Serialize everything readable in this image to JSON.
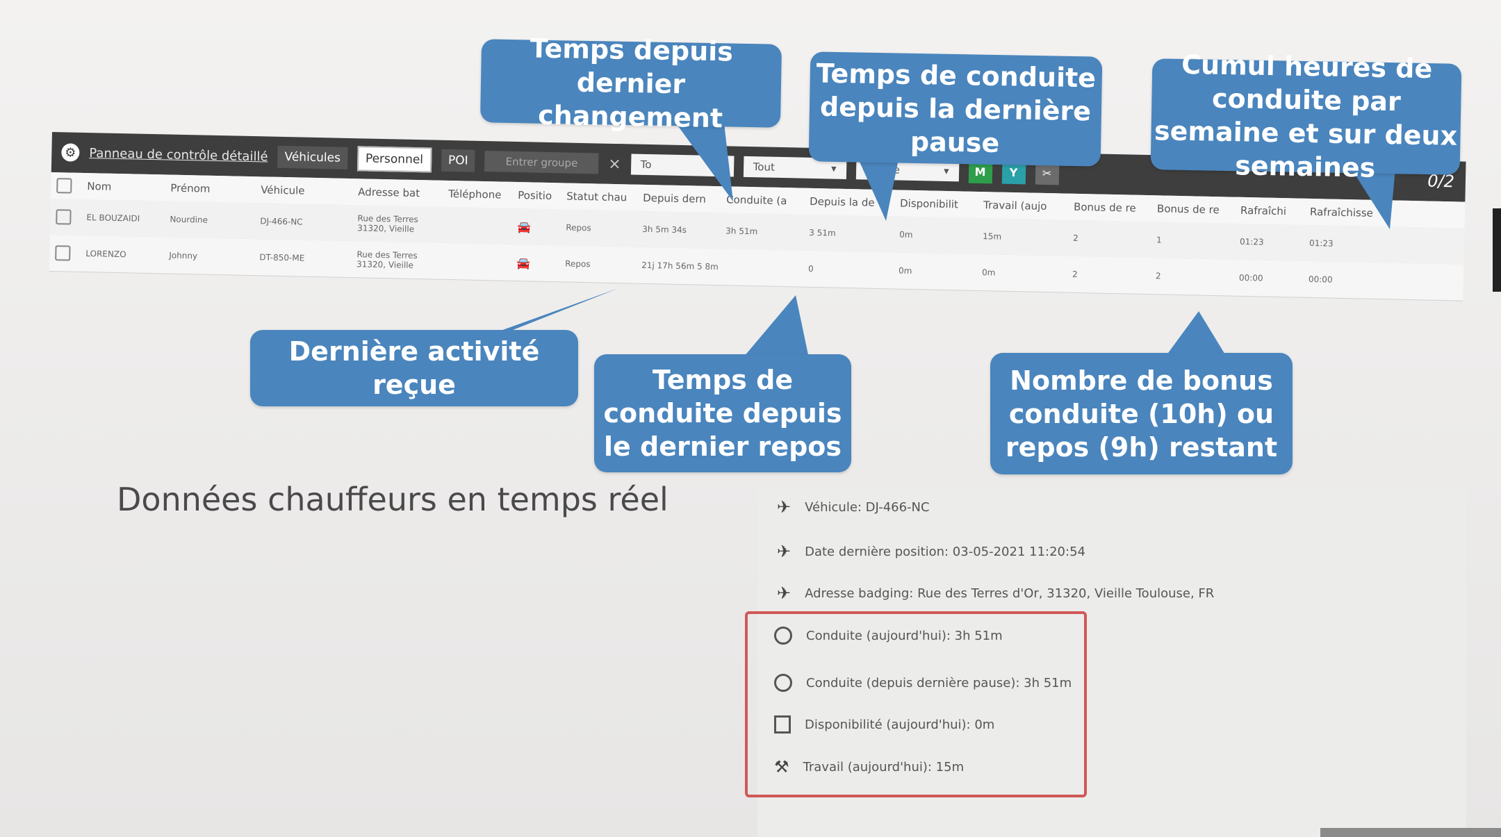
{
  "topbar": {
    "title": "Panneau de contrôle détaillé",
    "tabs": [
      "Véhicules",
      "Personnel",
      "POI"
    ],
    "group_placeholder": "Entrer groupe",
    "clear": "×",
    "selects": [
      "To",
      "Tout",
      "Tout le"
    ],
    "icon_buttons": [
      {
        "icon": "map-icon",
        "color": "#2e9e4b",
        "glyph": "M"
      },
      {
        "icon": "filter-icon",
        "color": "#2aa0a8",
        "glyph": "Y"
      },
      {
        "icon": "tools-icon",
        "color": "#6c6c6c",
        "glyph": "✂"
      }
    ],
    "count": "0/2"
  },
  "table": {
    "columns": [
      "Nom",
      "Prénom",
      "Véhicule",
      "Adresse bat",
      "Téléphone",
      "Positio",
      "Statut chau",
      "Depuis dern",
      "Conduite (a",
      "Depuis la de",
      "Disponibilit",
      "Travail (aujo",
      "Bonus de re",
      "Bonus de re",
      "Rafraîchi",
      "Rafraîchisse"
    ],
    "rows": [
      {
        "nom": "EL BOUZAIDI",
        "prenom": "Nourdine",
        "vehicule": "DJ-466-NC",
        "adresse": [
          "Rue des Terres",
          "31320, Vieille"
        ],
        "statut": "Repos",
        "depuis": "3h 5m 34s",
        "conduite": "3h 51m",
        "depuis_pause": "3 51m",
        "dispo": "0m",
        "travail": "15m",
        "bonus1": "2",
        "bonus2": "1",
        "rafr1": "01:23",
        "rafr2": "01:23"
      },
      {
        "nom": "LORENZO",
        "prenom": "Johnny",
        "vehicule": "DT-850-ME",
        "adresse": [
          "Rue des Terres",
          "31320, Vieille"
        ],
        "statut": "Repos",
        "depuis": "21j 17h 56m 5 8m",
        "conduite": "",
        "depuis_pause": "0",
        "dispo": "0m",
        "travail": "0m",
        "bonus1": "2",
        "bonus2": "2",
        "rafr1": "00:00",
        "rafr2": "00:00"
      }
    ]
  },
  "callouts": {
    "changement": "Temps depuis dernier changement",
    "pause": "Temps de conduite depuis la dernière pause",
    "cumul": "Cumul heures de conduite par semaine et sur deux semaines",
    "activite": "Dernière activité reçue",
    "repos": "Temps de conduite depuis le dernier repos",
    "bonus": "Nombre de bonus conduite (10h) ou repos (9h) restant"
  },
  "main_title": "Données chauffeurs en temps réel",
  "details": [
    {
      "icon": "pin-icon",
      "text": "Véhicule: DJ-466-NC"
    },
    {
      "icon": "pin-icon",
      "text": "Date dernière position: 03-05-2021 11:20:54"
    },
    {
      "icon": "pin-icon",
      "text": "Adresse badging: Rue des Terres d'Or, 31320, Vieille Toulouse, FR"
    },
    {
      "icon": "clock-icon",
      "text": "Conduite (aujourd'hui): 3h 51m"
    },
    {
      "icon": "clock-icon",
      "text": "Conduite (depuis dernière pause): 3h 51m"
    },
    {
      "icon": "square-icon",
      "text": "Disponibilité (aujourd'hui): 0m"
    },
    {
      "icon": "hammer-icon",
      "text": "Travail (aujourd'hui): 15m"
    }
  ],
  "colors": {
    "callout": "#4a85bd",
    "highlight": "#d15757",
    "topbar": "#3e3e3e"
  }
}
